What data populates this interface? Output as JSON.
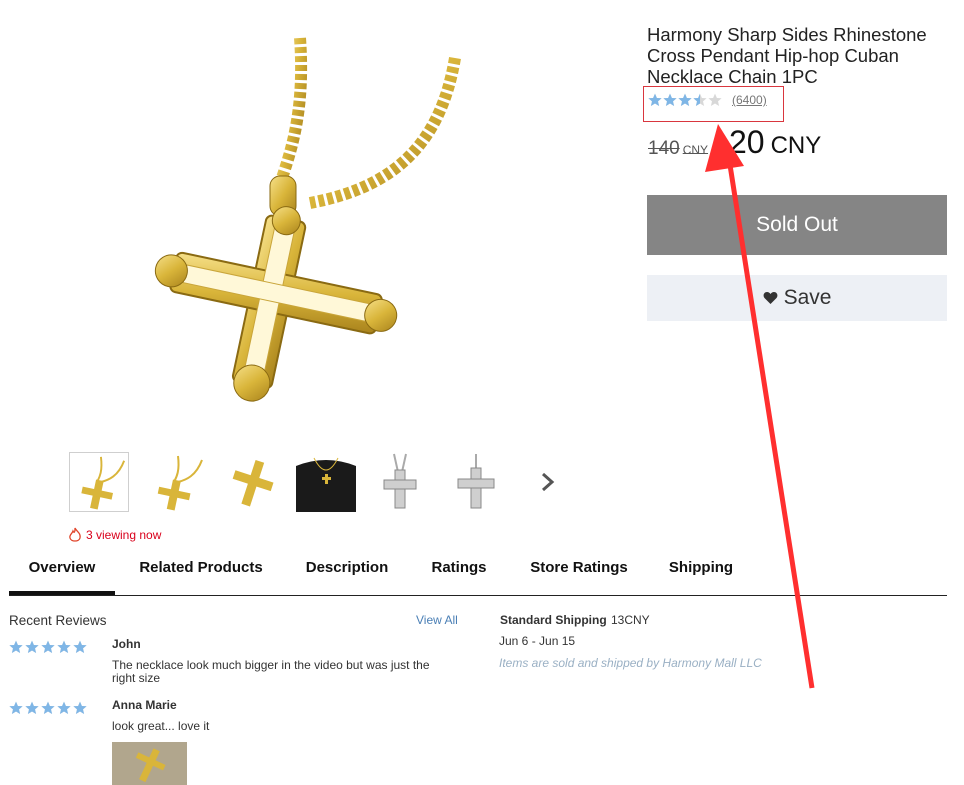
{
  "product": {
    "title": "Harmony Sharp Sides Rhinestone Cross Pendant Hip-hop Cuban Necklace Chain 1PC",
    "rating": 3.5,
    "rating_count": "(6400)",
    "old_price": "140",
    "old_currency": "CNY",
    "new_price": "20",
    "new_currency": "CNY",
    "sold_out_label": "Sold Out",
    "save_label": "Save",
    "viewing_text": "3 viewing now"
  },
  "thumbnails": [
    {
      "kind": "gold-cross"
    },
    {
      "kind": "gold-cross"
    },
    {
      "kind": "gold-cross"
    },
    {
      "kind": "worn-on-black-shirt"
    },
    {
      "kind": "silver-cross"
    },
    {
      "kind": "silver-cross"
    }
  ],
  "tabs": [
    {
      "label": "Overview",
      "active": true
    },
    {
      "label": "Related Products",
      "active": false
    },
    {
      "label": "Description",
      "active": false
    },
    {
      "label": "Ratings",
      "active": false
    },
    {
      "label": "Store Ratings",
      "active": false
    },
    {
      "label": "Shipping",
      "active": false
    }
  ],
  "reviews": {
    "title": "Recent Reviews",
    "view_all": "View All",
    "items": [
      {
        "name": "John",
        "stars": 5,
        "text": "The necklace look much bigger in the video but was just the right size"
      },
      {
        "name": "Anna Marie",
        "stars": 5,
        "text": "look great... love it"
      }
    ]
  },
  "shipping": {
    "label": "Standard Shipping",
    "price": "13CNY",
    "dates": "Jun 6 - Jun 15",
    "note": "Items are sold and shipped by Harmony Mall LLC"
  },
  "colors": {
    "star": "#7fb6e6",
    "star_empty": "#d8d8d8",
    "highlight": "#d9363e",
    "sold_out_bg": "#858585",
    "save_bg": "#edf0f5",
    "viewing": "#d9001b",
    "gold": "#d9b53a"
  },
  "icons": [
    "fire-icon",
    "heart-icon",
    "chevron-right-icon",
    "star-icon"
  ]
}
